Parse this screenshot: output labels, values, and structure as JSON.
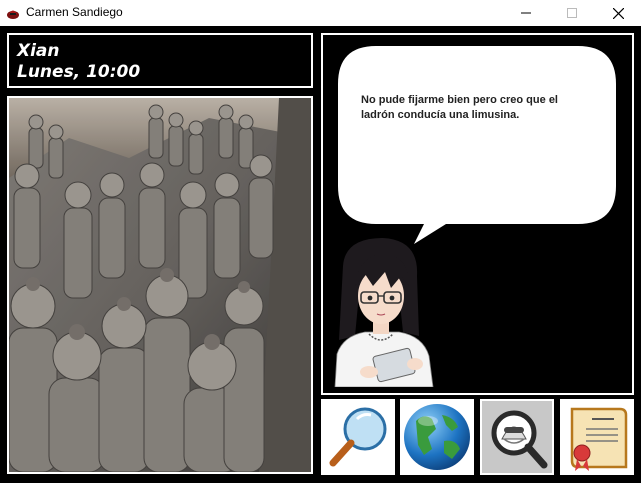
{
  "window": {
    "title": "Carmen Sandiego",
    "minimize_icon": "minimize-icon",
    "maximize_icon": "maximize-icon",
    "close_icon": "close-icon"
  },
  "location": {
    "city": "Xian",
    "datetime": "Lunes, 10:00"
  },
  "photo": {
    "subject": "terracotta-army-photo"
  },
  "dialog": {
    "text": "No pude fijarme bien pero creo que el ladrón conducía una limusina."
  },
  "toolbar": {
    "buttons": [
      {
        "icon": "magnifier-icon"
      },
      {
        "icon": "globe-icon"
      },
      {
        "icon": "suspect-search-icon"
      },
      {
        "icon": "warrant-icon"
      }
    ]
  },
  "colors": {
    "background": "#000000",
    "border": "#ffffff",
    "bubble": "#ffffff"
  }
}
